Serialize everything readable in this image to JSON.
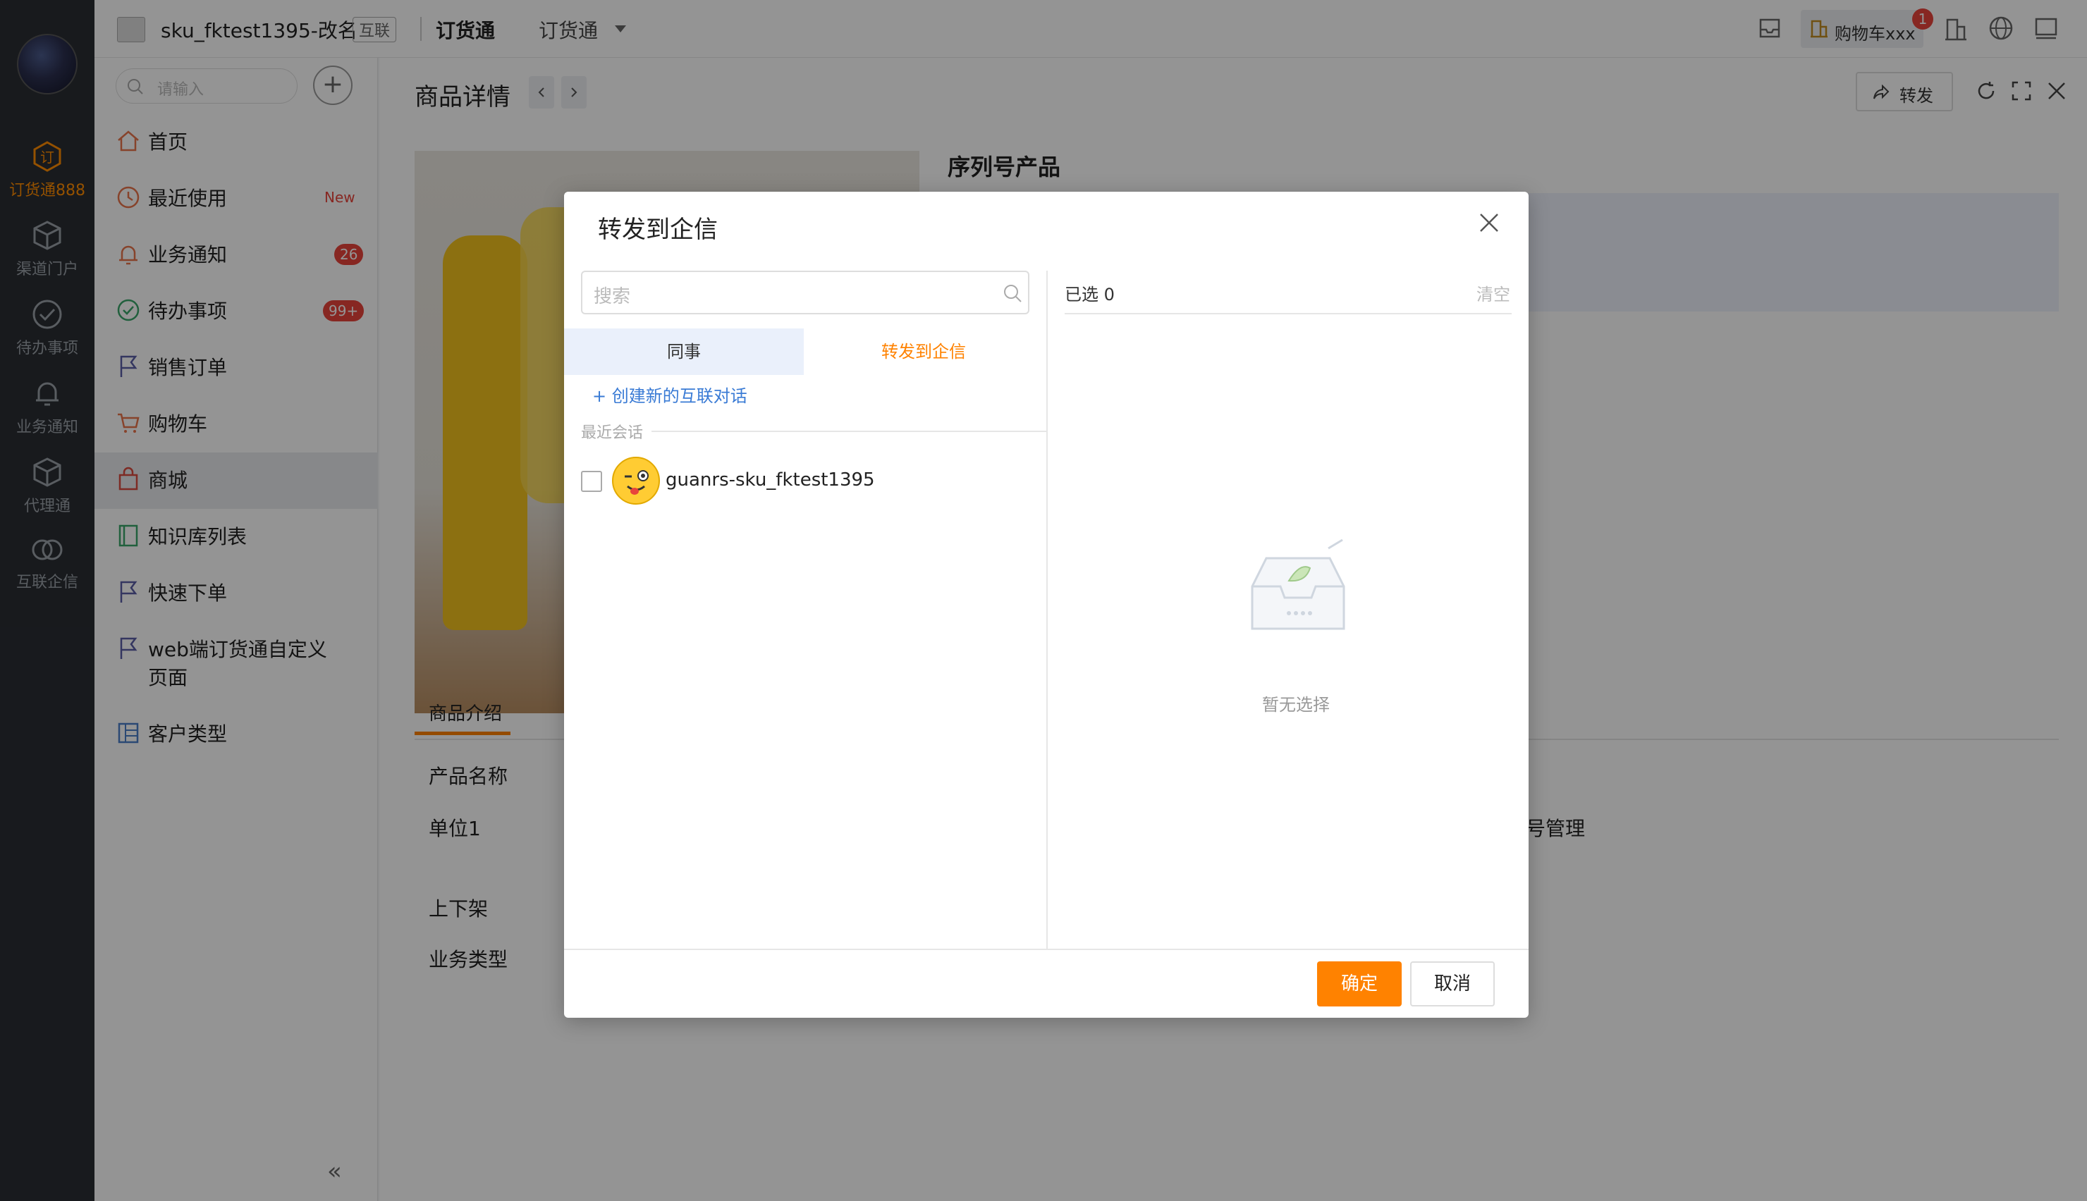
{
  "rail": {
    "items": [
      {
        "label": "订货通888",
        "icon": "order-icon",
        "active": true
      },
      {
        "label": "渠道门户",
        "icon": "cube-icon"
      },
      {
        "label": "待办事项",
        "icon": "check-circle-icon"
      },
      {
        "label": "业务通知",
        "icon": "bell-icon"
      },
      {
        "label": "代理通",
        "icon": "cube-icon"
      },
      {
        "label": "互联企信",
        "icon": "link-circles-icon"
      }
    ]
  },
  "topbar": {
    "app_name": "sku_fktest1395-改名",
    "tag": "互联",
    "crumb_active": "订货通",
    "crumb_dropdown": "订货通",
    "cart": "购物车xxx",
    "cart_count": "1"
  },
  "nav": {
    "search_placeholder": "请输入",
    "add_label": "+",
    "items": [
      {
        "label": "首页",
        "icon": "home-icon"
      },
      {
        "label": "最近使用",
        "icon": "clock-icon",
        "badge": "New"
      },
      {
        "label": "业务通知",
        "icon": "bell-icon",
        "badge": "26"
      },
      {
        "label": "待办事项",
        "icon": "check-circle-icon",
        "badge": "99+"
      },
      {
        "label": "销售订单",
        "icon": "flag-icon"
      },
      {
        "label": "购物车",
        "icon": "cart-icon"
      },
      {
        "label": "商城",
        "icon": "shop-icon",
        "active": true
      },
      {
        "label": "知识库列表",
        "icon": "book-icon"
      },
      {
        "label": "快速下单",
        "icon": "flag-icon"
      },
      {
        "label": "web端订货通自定义",
        "label2": "页面",
        "icon": "flag-icon"
      },
      {
        "label": "客户类型",
        "icon": "table-icon"
      }
    ],
    "collapse": "«"
  },
  "main": {
    "title": "商品详情",
    "forward": "转发",
    "product_name": "序列号产品",
    "tab": "商品介绍",
    "fields": [
      "产品名称",
      "单位1",
      "上下架",
      "业务类型"
    ],
    "right_field": "号管理"
  },
  "modal": {
    "title": "转发到企信",
    "search_placeholder": "搜索",
    "tab_colleagues": "同事",
    "tab_forward": "转发到企信",
    "create_link": "+ 创建新的互联对话",
    "recent_label": "最近会话",
    "conversation": "guanrs-sku_fktest1395",
    "selected_label": "已选 0",
    "clear_label": "清空",
    "empty_text": "暂无选择",
    "ok": "确定",
    "cancel": "取消"
  }
}
